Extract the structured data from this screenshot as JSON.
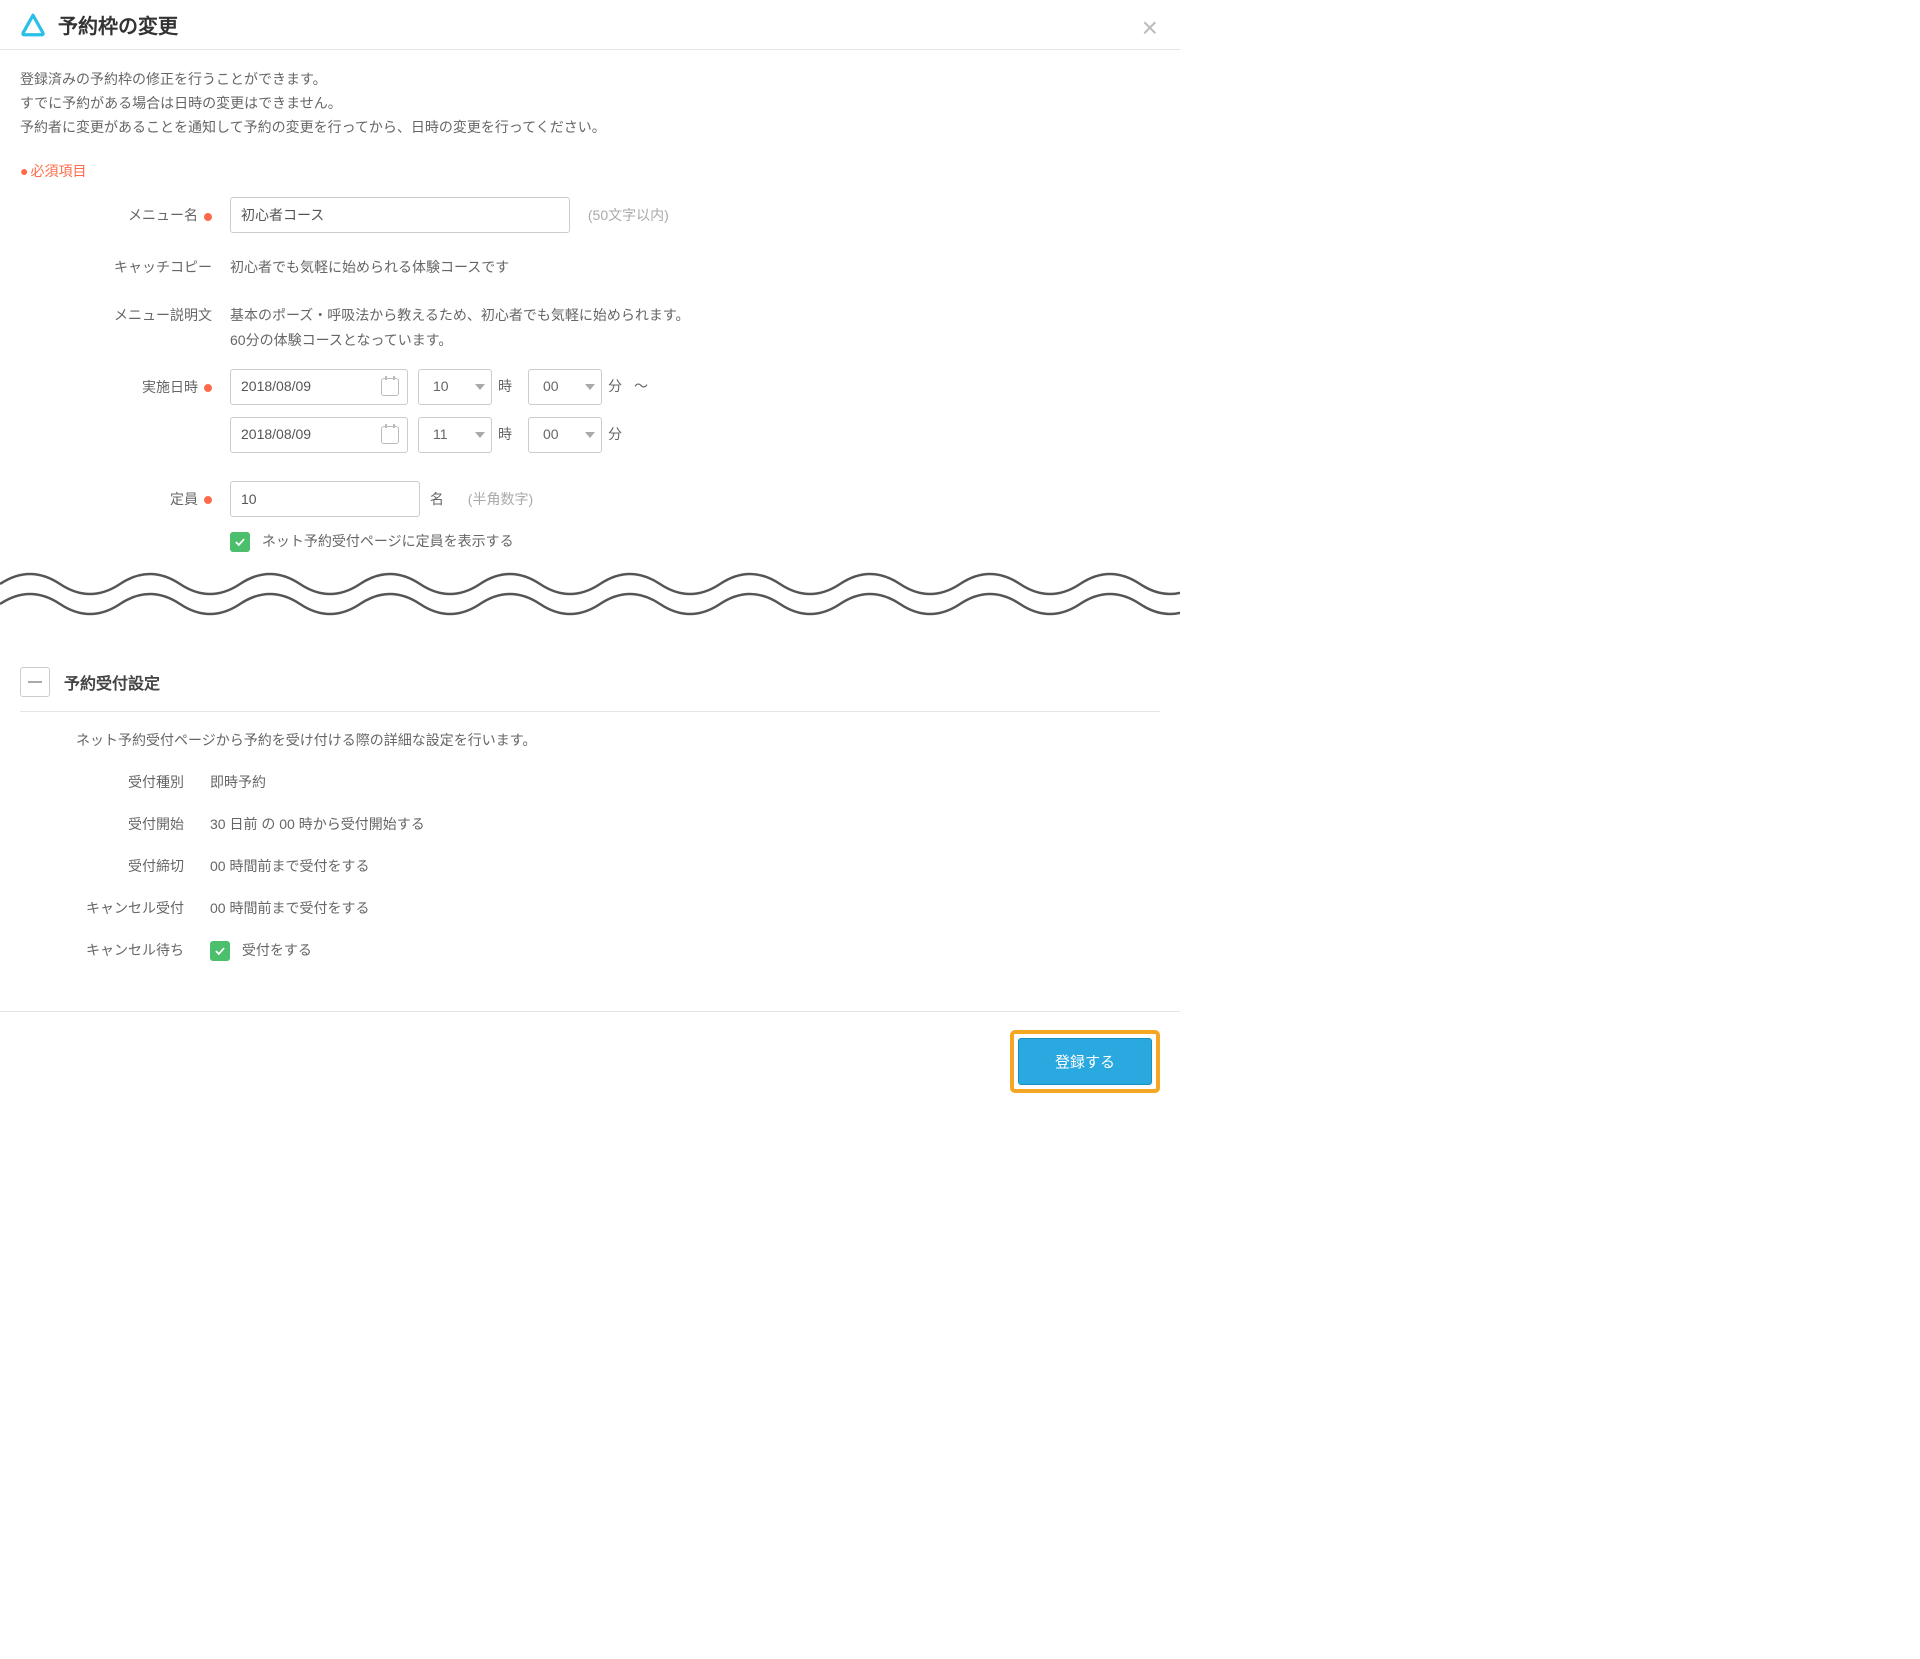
{
  "header": {
    "title": "予約枠の変更"
  },
  "intro": {
    "line1": "登録済みの予約枠の修正を行うことができます。",
    "line2": "すでに予約がある場合は日時の変更はできません。",
    "line3": "予約者に変更があることを通知して予約の変更を行ってから、日時の変更を行ってください。"
  },
  "required_legend": "必須項目",
  "fields": {
    "menu_name": {
      "label": "メニュー名",
      "value": "初心者コース",
      "hint": "(50文字以内)"
    },
    "catch_copy": {
      "label": "キャッチコピー",
      "value": "初心者でも気軽に始められる体験コースです"
    },
    "description": {
      "label": "メニュー説明文",
      "line1": "基本のポーズ・呼吸法から教えるため、初心者でも気軽に始められます。",
      "line2": "60分の体験コースとなっています。"
    },
    "datetime": {
      "label": "実施日時",
      "start_date": "2018/08/09",
      "start_hour": "10",
      "start_min": "00",
      "end_date": "2018/08/09",
      "end_hour": "11",
      "end_min": "00",
      "ji": "時",
      "fun": "分",
      "tilde": "～"
    },
    "capacity": {
      "label": "定員",
      "value": "10",
      "unit": "名",
      "hint": "(半角数字)",
      "checkbox_label": "ネット予約受付ページに定員を表示する"
    }
  },
  "reception_section": {
    "title": "予約受付設定",
    "intro": "ネット予約受付ページから予約を受け付ける際の詳細な設定を行います。",
    "rows": {
      "type": {
        "label": "受付種別",
        "value": "即時予約"
      },
      "start": {
        "label": "受付開始",
        "value": "30 日前 の 00 時から受付開始する"
      },
      "deadline": {
        "label": "受付締切",
        "value": "00 時間前まで受付をする"
      },
      "cancel": {
        "label": "キャンセル受付",
        "value": "00 時間前まで受付をする"
      },
      "waitlist": {
        "label": "キャンセル待ち",
        "value": "受付をする"
      }
    }
  },
  "footer": {
    "submit": "登録する"
  }
}
